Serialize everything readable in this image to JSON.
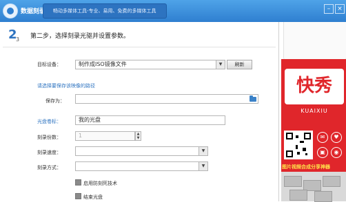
{
  "header": {
    "app_title": "数据刻录",
    "slogan": "畅动多媒体工具-专业、易用、免费的多媒体工具"
  },
  "step": {
    "current": "2",
    "total": "3",
    "title": "第二步，选择刻录光驱并设置参数。"
  },
  "form": {
    "target_device_label": "目标设备：",
    "target_device_value": "制作成ISO镜像文件",
    "refresh_button": "刷新",
    "save_path_hint": "请选择要保存该映像的路径",
    "save_as_label": "保存为：",
    "save_as_value": "",
    "disc_label_label": "光盘卷标：",
    "disc_label_value": "我的光盘",
    "copies_label": "刻录份数：",
    "copies_value": "1",
    "speed_label": "刻录速度：",
    "speed_value": "",
    "mode_label": "刻录方式：",
    "mode_value": "",
    "burnproof_label": "启用防刻死技术",
    "finalize_label": "结束光盘"
  },
  "ad": {
    "brand_cn": "快秀",
    "brand_en": "KUAIXIU",
    "slogan": "图片视频合成分享神器"
  },
  "colors": {
    "title_bar": "#2f7fd0",
    "accent": "#2d73c0",
    "ad_red": "#e0262b"
  }
}
